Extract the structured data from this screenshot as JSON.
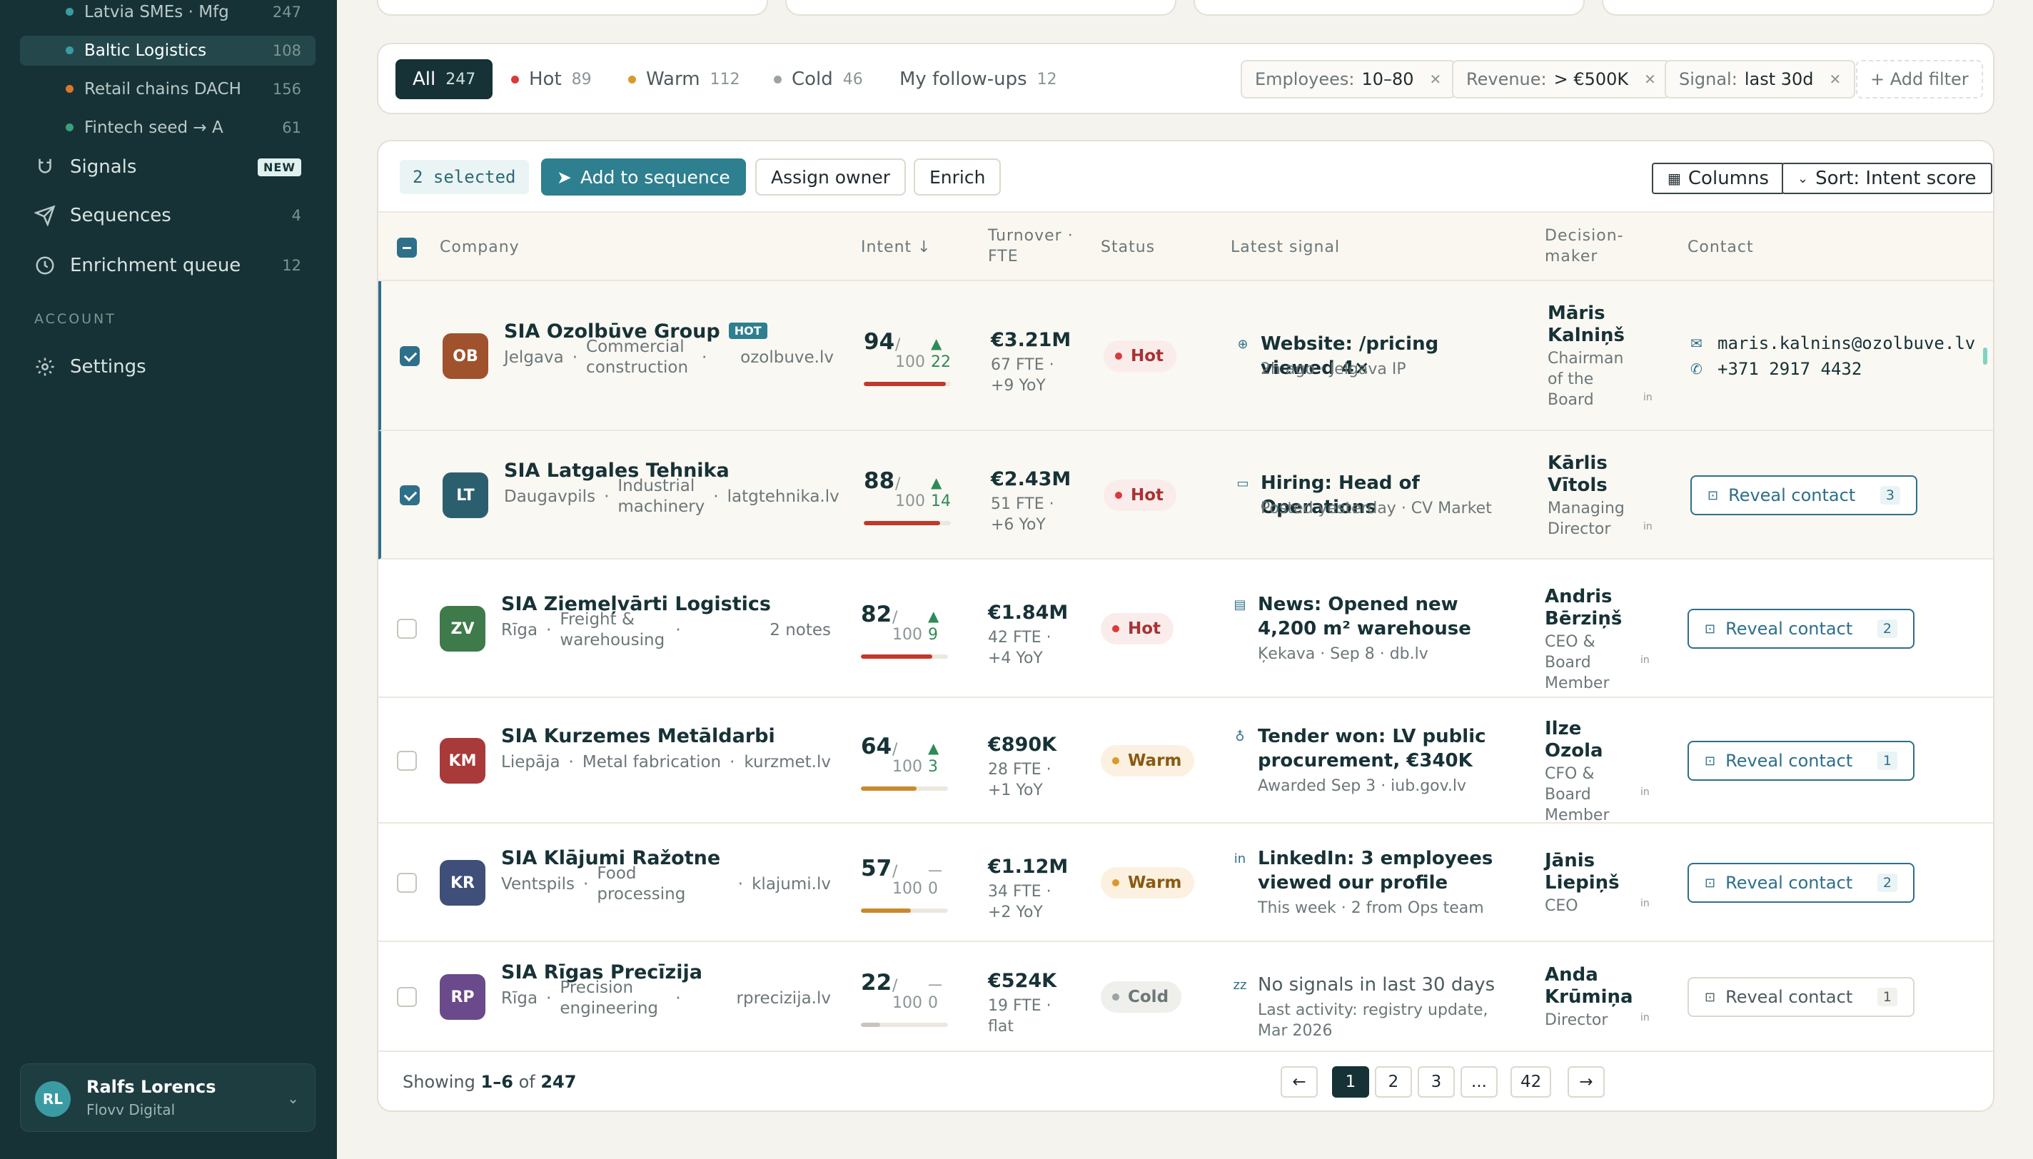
{
  "sidebar": {
    "segments": [
      {
        "label": "Latvia SMEs · Mfg",
        "count": "247",
        "color": "#3a9ca2",
        "active": false
      },
      {
        "label": "Baltic Logistics",
        "count": "108",
        "color": "#3a9ca2",
        "active": true
      },
      {
        "label": "Retail chains DACH",
        "count": "156",
        "color": "#d9772b",
        "active": false
      },
      {
        "label": "Fintech seed → A",
        "count": "61",
        "color": "#3aa07a",
        "active": false
      }
    ],
    "nav": [
      {
        "label": "Signals",
        "badge": "NEW",
        "icon": "magnet-icon"
      },
      {
        "label": "Sequences",
        "count": "4",
        "icon": "send-icon"
      },
      {
        "label": "Enrichment queue",
        "count": "12",
        "icon": "clock-icon"
      }
    ],
    "account_section": "ACCOUNT",
    "settings_label": "Settings",
    "user": {
      "initials": "RL",
      "name": "Ralfs Lorencs",
      "company": "Flovv Digital"
    }
  },
  "filters": {
    "segments": [
      {
        "label": "All",
        "count": "247"
      },
      {
        "label": "Hot",
        "count": "89",
        "color": "#d93a3a"
      },
      {
        "label": "Warm",
        "count": "112",
        "color": "#d99a2b"
      },
      {
        "label": "Cold",
        "count": "46",
        "color": "#9ca3a4"
      },
      {
        "label": "My follow-ups",
        "count": "12"
      }
    ],
    "chips": [
      {
        "key": "Employees:",
        "value": "10–80"
      },
      {
        "key": "Revenue:",
        "value": "> €500K"
      },
      {
        "key": "Signal:",
        "value": "last 30d"
      }
    ],
    "add_filter": "+ Add filter"
  },
  "toolbar": {
    "selected": "2 selected",
    "add_to_sequence": "Add to sequence",
    "assign_owner": "Assign owner",
    "enrich": "Enrich",
    "columns": "Columns",
    "sort": "Sort: Intent score"
  },
  "columns": {
    "company": "Company",
    "intent": "Intent ↓",
    "turnover": "Turnover · FTE",
    "status": "Status",
    "signal": "Latest signal",
    "decision_maker": "Decision-maker",
    "contact": "Contact"
  },
  "rows": [
    {
      "selected": true,
      "initials": "OB",
      "avatar_color": "#a0522d",
      "name": "SIA Ozolbūve Group",
      "hot_badge": "HOT",
      "city": "Jelgava",
      "industry": "Commercial construction",
      "domain": "ozolbuve.lv",
      "score": "94",
      "out_of": "100",
      "trend": "▲",
      "delta": "22",
      "score_pct": 0.94,
      "bar_color": "#c0392b",
      "turnover": "€3.21M",
      "fte": "67 FTE · +9 YoY",
      "status": "Hot",
      "signal_icon": "globe-icon",
      "signal_glyph": "⊕",
      "signal_title": "Website: /pricing viewed 4×",
      "signal_sub": "2h ago · Jelgava IP",
      "dm_name": "Māris Kalniņš",
      "dm_role": "Chairman of the Board",
      "email": "maris.kalnins@ozolbuve.lv",
      "phone": "+371 2917 4432"
    },
    {
      "selected": true,
      "initials": "LT",
      "avatar_color": "#2c5f6e",
      "name": "SIA Latgales Tehnika",
      "city": "Daugavpils",
      "industry": "Industrial machinery",
      "domain": "latgtehnika.lv",
      "score": "88",
      "out_of": "100",
      "trend": "▲",
      "delta": "14",
      "score_pct": 0.88,
      "bar_color": "#c0392b",
      "turnover": "€2.43M",
      "fte": "51 FTE · +6 YoY",
      "status": "Hot",
      "signal_icon": "briefcase-icon",
      "signal_glyph": "▭",
      "signal_title": "Hiring: Head of Operations",
      "signal_sub": "Posted yesterday · CV Market",
      "dm_name": "Kārlis Vītols",
      "dm_role": "Managing Director",
      "reveal": "Reveal contact",
      "reveal_count": "3"
    },
    {
      "selected": false,
      "initials": "ZV",
      "avatar_color": "#3f7a4a",
      "name": "SIA Ziemeļvārti Logistics",
      "city": "Rīga",
      "industry": "Freight & warehousing",
      "domain": "2 notes",
      "score": "82",
      "out_of": "100",
      "trend": "▲",
      "delta": "9",
      "score_pct": 0.82,
      "bar_color": "#c0392b",
      "turnover": "€1.84M",
      "fte": "42 FTE · +4 YoY",
      "status": "Hot",
      "signal_icon": "newspaper-icon",
      "signal_glyph": "▤",
      "signal_title": "News: Opened new 4,200 m² warehouse",
      "signal_sub": "Ķekava · Sep 8 · db.lv",
      "dm_name": "Andris Bērziņš",
      "dm_role": "CEO & Board Member",
      "reveal": "Reveal contact",
      "reveal_count": "2"
    },
    {
      "selected": false,
      "initials": "KM",
      "avatar_color": "#a83a3a",
      "name": "SIA Kurzemes Metāldarbi",
      "city": "Liepāja",
      "industry": "Metal fabrication",
      "domain": "kurzmet.lv",
      "score": "64",
      "out_of": "100",
      "trend": "▲",
      "delta": "3",
      "score_pct": 0.64,
      "bar_color": "#c98a2b",
      "turnover": "€890K",
      "fte": "28 FTE · +1 YoY",
      "status": "Warm",
      "signal_icon": "award-icon",
      "signal_glyph": "♁",
      "signal_title": "Tender won: LV public procurement, €340K",
      "signal_sub": "Awarded Sep 3 · iub.gov.lv",
      "dm_name": "Ilze Ozola",
      "dm_role": "CFO & Board Member",
      "reveal": "Reveal contact",
      "reveal_count": "1"
    },
    {
      "selected": false,
      "initials": "KR",
      "avatar_color": "#3f4f7a",
      "name": "SIA Klājumi Ražotne",
      "city": "Ventspils",
      "industry": "Food processing",
      "domain": "klajumi.lv",
      "score": "57",
      "out_of": "100",
      "trend": "—",
      "delta": "0",
      "score_pct": 0.57,
      "bar_color": "#c98a2b",
      "turnover": "€1.12M",
      "fte": "34 FTE · +2 YoY",
      "status": "Warm",
      "signal_icon": "linkedin-icon",
      "signal_glyph": "in",
      "signal_title": "LinkedIn: 3 employees viewed our profile",
      "signal_sub": "This week · 2 from Ops team",
      "dm_name": "Jānis Liepiņš",
      "dm_role": "CEO",
      "reveal": "Reveal contact",
      "reveal_count": "2"
    },
    {
      "selected": false,
      "initials": "RP",
      "avatar_color": "#6a4a8a",
      "name": "SIA Rīgas Precīzija",
      "city": "Rīga",
      "industry": "Precision engineering",
      "domain": "rprecizija.lv",
      "score": "22",
      "out_of": "100",
      "trend": "—",
      "delta": "0",
      "score_pct": 0.22,
      "bar_color": "#c9c5bc",
      "turnover": "€524K",
      "fte": "19 FTE · flat",
      "status": "Cold",
      "signal_icon": "sleep-icon",
      "signal_glyph": "zz",
      "signal_title": "No signals in last 30 days",
      "signal_sub": "Last activity: registry update, Mar 2026",
      "dm_name": "Anda Krūmiņa",
      "dm_role": "Director",
      "reveal": "Reveal contact",
      "reveal_count": "1"
    }
  ],
  "footer": {
    "showing_prefix": "Showing",
    "showing_range": "1–6",
    "showing_of": "of",
    "showing_total": "247",
    "pages": [
      "←",
      "1",
      "2",
      "3",
      "...",
      "42",
      "→"
    ],
    "current_page": "1"
  }
}
